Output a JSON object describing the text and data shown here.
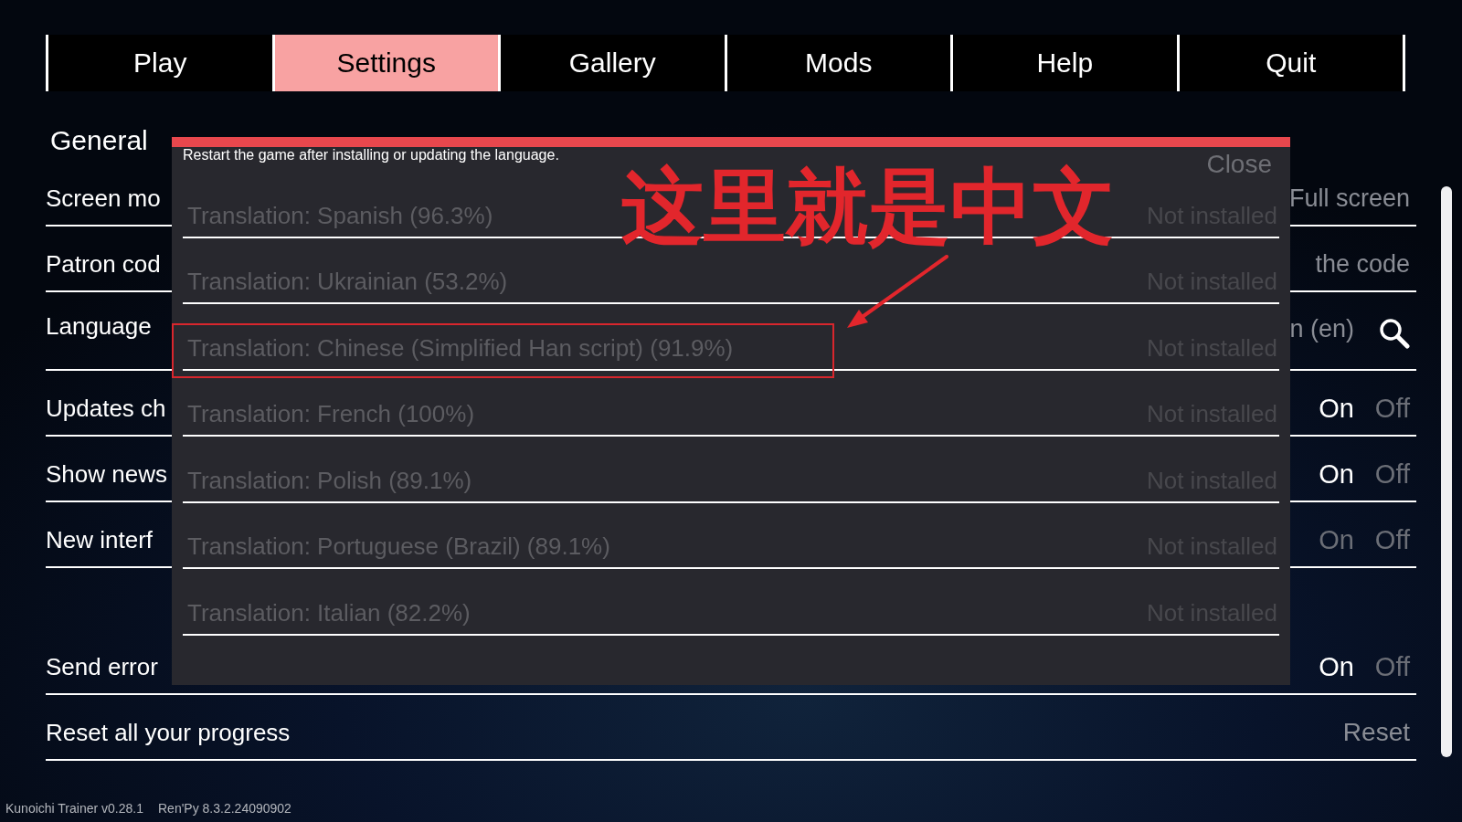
{
  "nav_tabs": [
    {
      "label": "Play",
      "selected": false
    },
    {
      "label": "Settings",
      "selected": true
    },
    {
      "label": "Gallery",
      "selected": false
    },
    {
      "label": "Mods",
      "selected": false
    },
    {
      "label": "Help",
      "selected": false
    },
    {
      "label": "Quit",
      "selected": false
    }
  ],
  "settings": {
    "sub_tabs": [
      {
        "label": "General",
        "selected": true
      }
    ],
    "sections": [
      {
        "rows": [
          {
            "kind": "value",
            "label": "Screen mo",
            "value": "Full screen"
          },
          {
            "kind": "value",
            "label": "Patron cod",
            "value": "the code"
          },
          {
            "kind": "search",
            "label": "Language",
            "value": "n (en)"
          },
          {
            "kind": "toggle",
            "label": "Updates ch",
            "options": [
              {
                "label": "On",
                "selected": true
              },
              {
                "label": "Off",
                "selected": false
              }
            ]
          },
          {
            "kind": "toggle",
            "label": "Show news",
            "options": [
              {
                "label": "On",
                "selected": true
              },
              {
                "label": "Off",
                "selected": false
              }
            ]
          },
          {
            "kind": "toggle",
            "label": "New interf",
            "options": [
              {
                "label": "On",
                "selected": false
              },
              {
                "label": "Off",
                "selected": false
              }
            ]
          }
        ]
      },
      {
        "rows": [
          {
            "kind": "toggle",
            "label": "Send error",
            "options": [
              {
                "label": "On",
                "selected": true
              },
              {
                "label": "Off",
                "selected": false
              }
            ]
          },
          {
            "kind": "button",
            "label": "Reset all your progress",
            "button": "Reset"
          }
        ]
      }
    ]
  },
  "language_dialog": {
    "message": "Restart the game after installing or updating the language.",
    "close": "Close",
    "translations": [
      {
        "name": "Translation: Spanish (96.3%)",
        "status": "Not installed",
        "highlighted": false
      },
      {
        "name": "Translation: Ukrainian (53.2%)",
        "status": "Not installed",
        "highlighted": false
      },
      {
        "name": "Translation: Chinese (Simplified Han script) (91.9%)",
        "status": "Not installed",
        "highlighted": true
      },
      {
        "name": "Translation: French (100%)",
        "status": "Not installed",
        "highlighted": false
      },
      {
        "name": "Translation: Polish (89.1%)",
        "status": "Not installed",
        "highlighted": false
      },
      {
        "name": "Translation: Portuguese (Brazil) (89.1%)",
        "status": "Not installed",
        "highlighted": false
      },
      {
        "name": "Translation: Italian (82.2%)",
        "status": "Not installed",
        "highlighted": false
      }
    ]
  },
  "annotation": {
    "text": "这里就是中文"
  },
  "version_info": [
    "Kunoichi Trainer v0.28.1",
    "Ren'Py 8.3.2.24090902"
  ]
}
